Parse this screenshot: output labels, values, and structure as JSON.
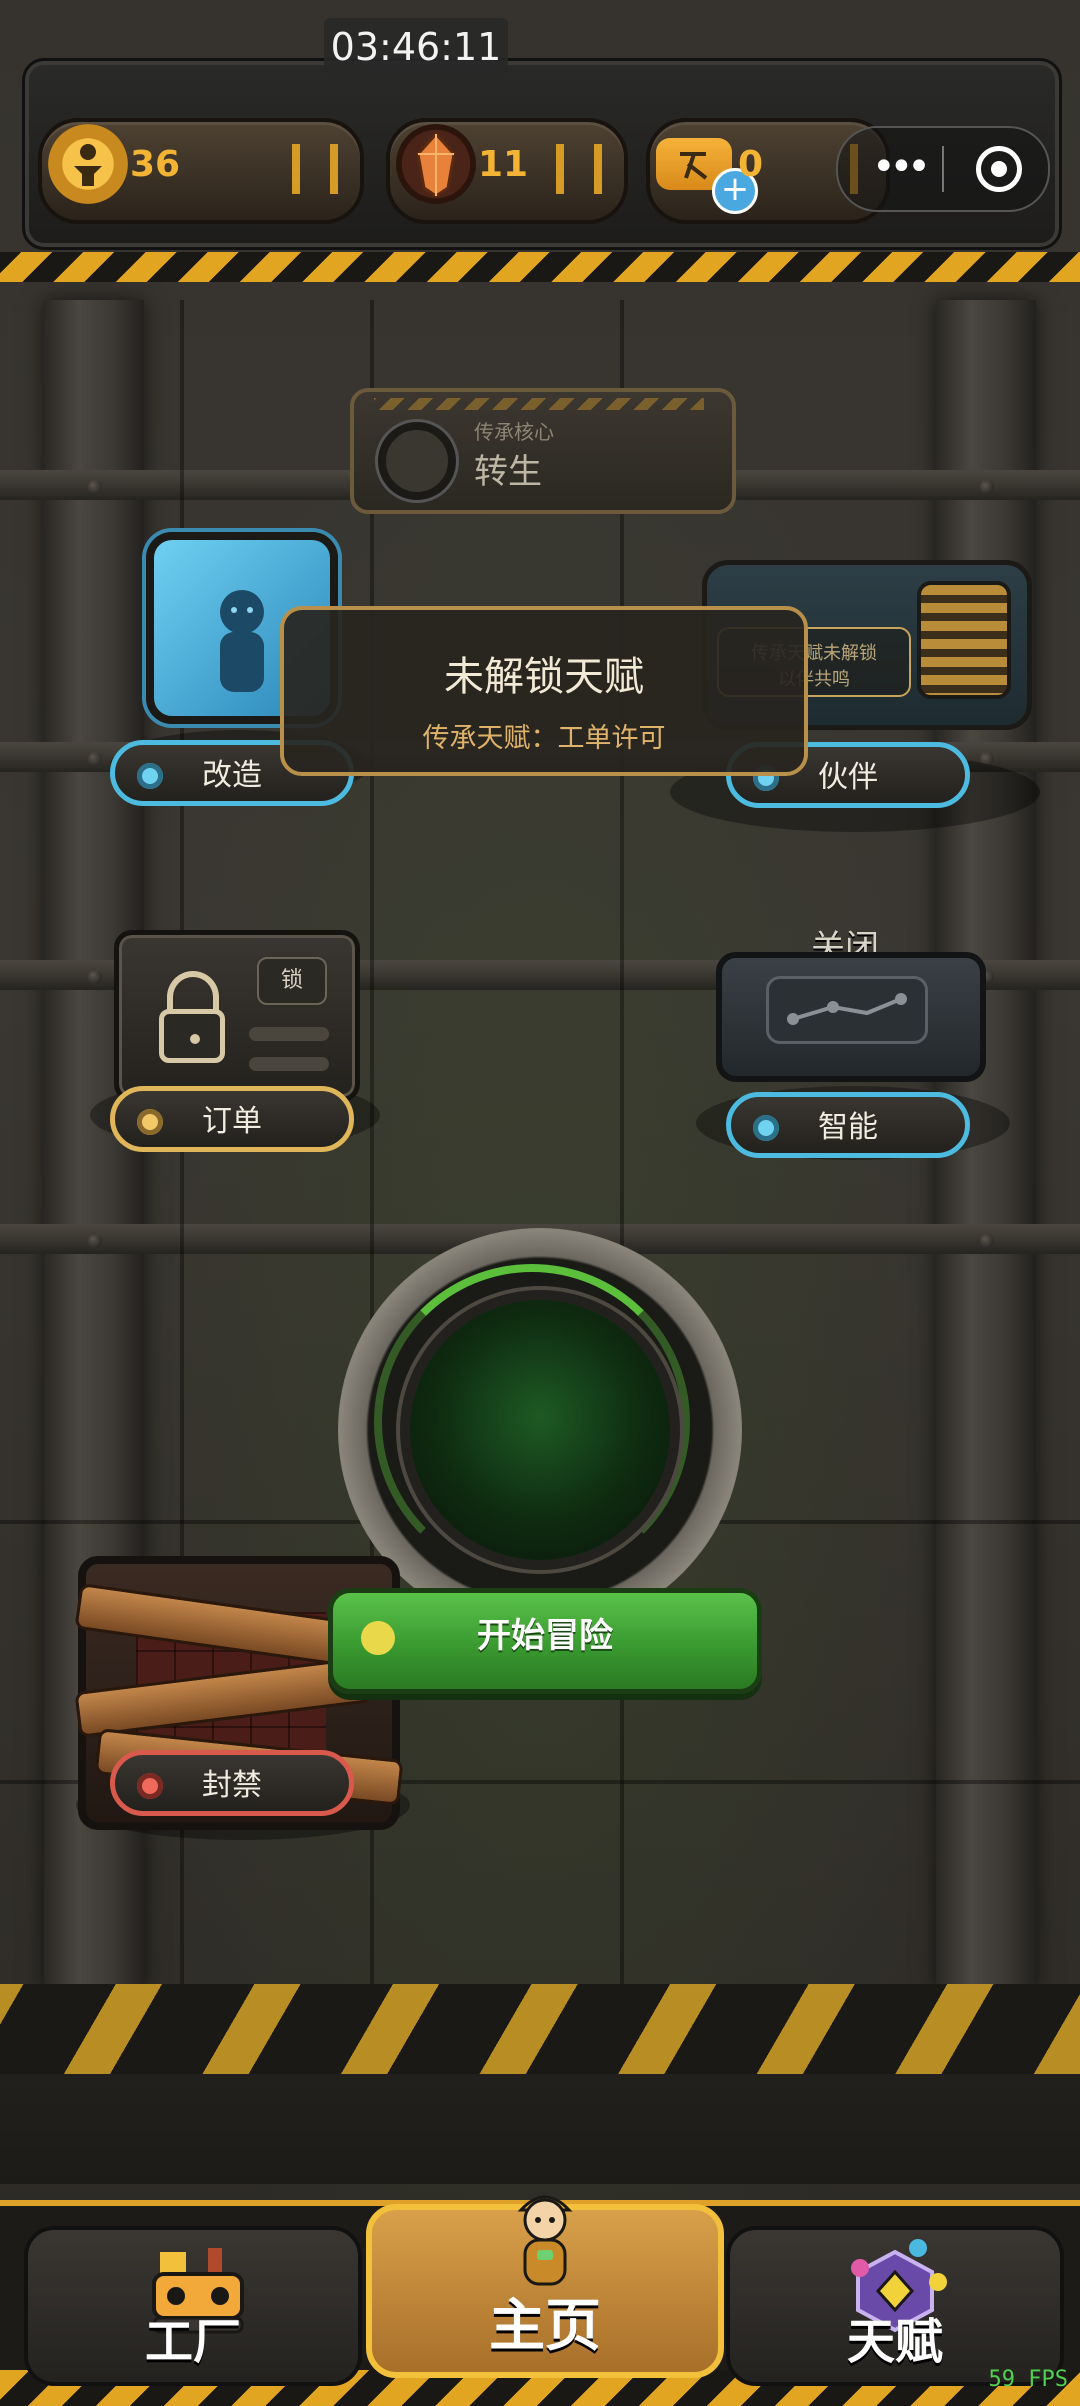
{
  "status": {
    "clock": "03:46:11",
    "fps": "59 FPS"
  },
  "resources": [
    {
      "id": "coins",
      "icon": "worker-coin-icon",
      "value": "36"
    },
    {
      "id": "crystals",
      "icon": "crystal-icon",
      "value": "11"
    },
    {
      "id": "tickets",
      "icon": "ticket-plus-icon",
      "value": "0"
    }
  ],
  "rebirth": {
    "subtitle": "传承核心",
    "title": "转生"
  },
  "popup": {
    "title": "未解锁天赋",
    "subtitle": "传承天赋：工单许可"
  },
  "stations": {
    "modify": "改造",
    "partner": "伙伴",
    "partner_info_line1": "传承天赋未解锁",
    "partner_info_line2": "以伴共鸣",
    "order": "订单",
    "lock_tag": "锁",
    "smart": "智能",
    "smart_toggle": "关闭",
    "sealed": "封禁"
  },
  "start_button": "开始冒险",
  "nav": {
    "factory": "工厂",
    "home": "主页",
    "talent": "天赋",
    "active": "home"
  },
  "colors": {
    "accent_gold": "#e0a12a",
    "accent_blue": "#4dbbe0",
    "accent_green": "#3a9a30",
    "accent_red": "#d95a4d"
  }
}
